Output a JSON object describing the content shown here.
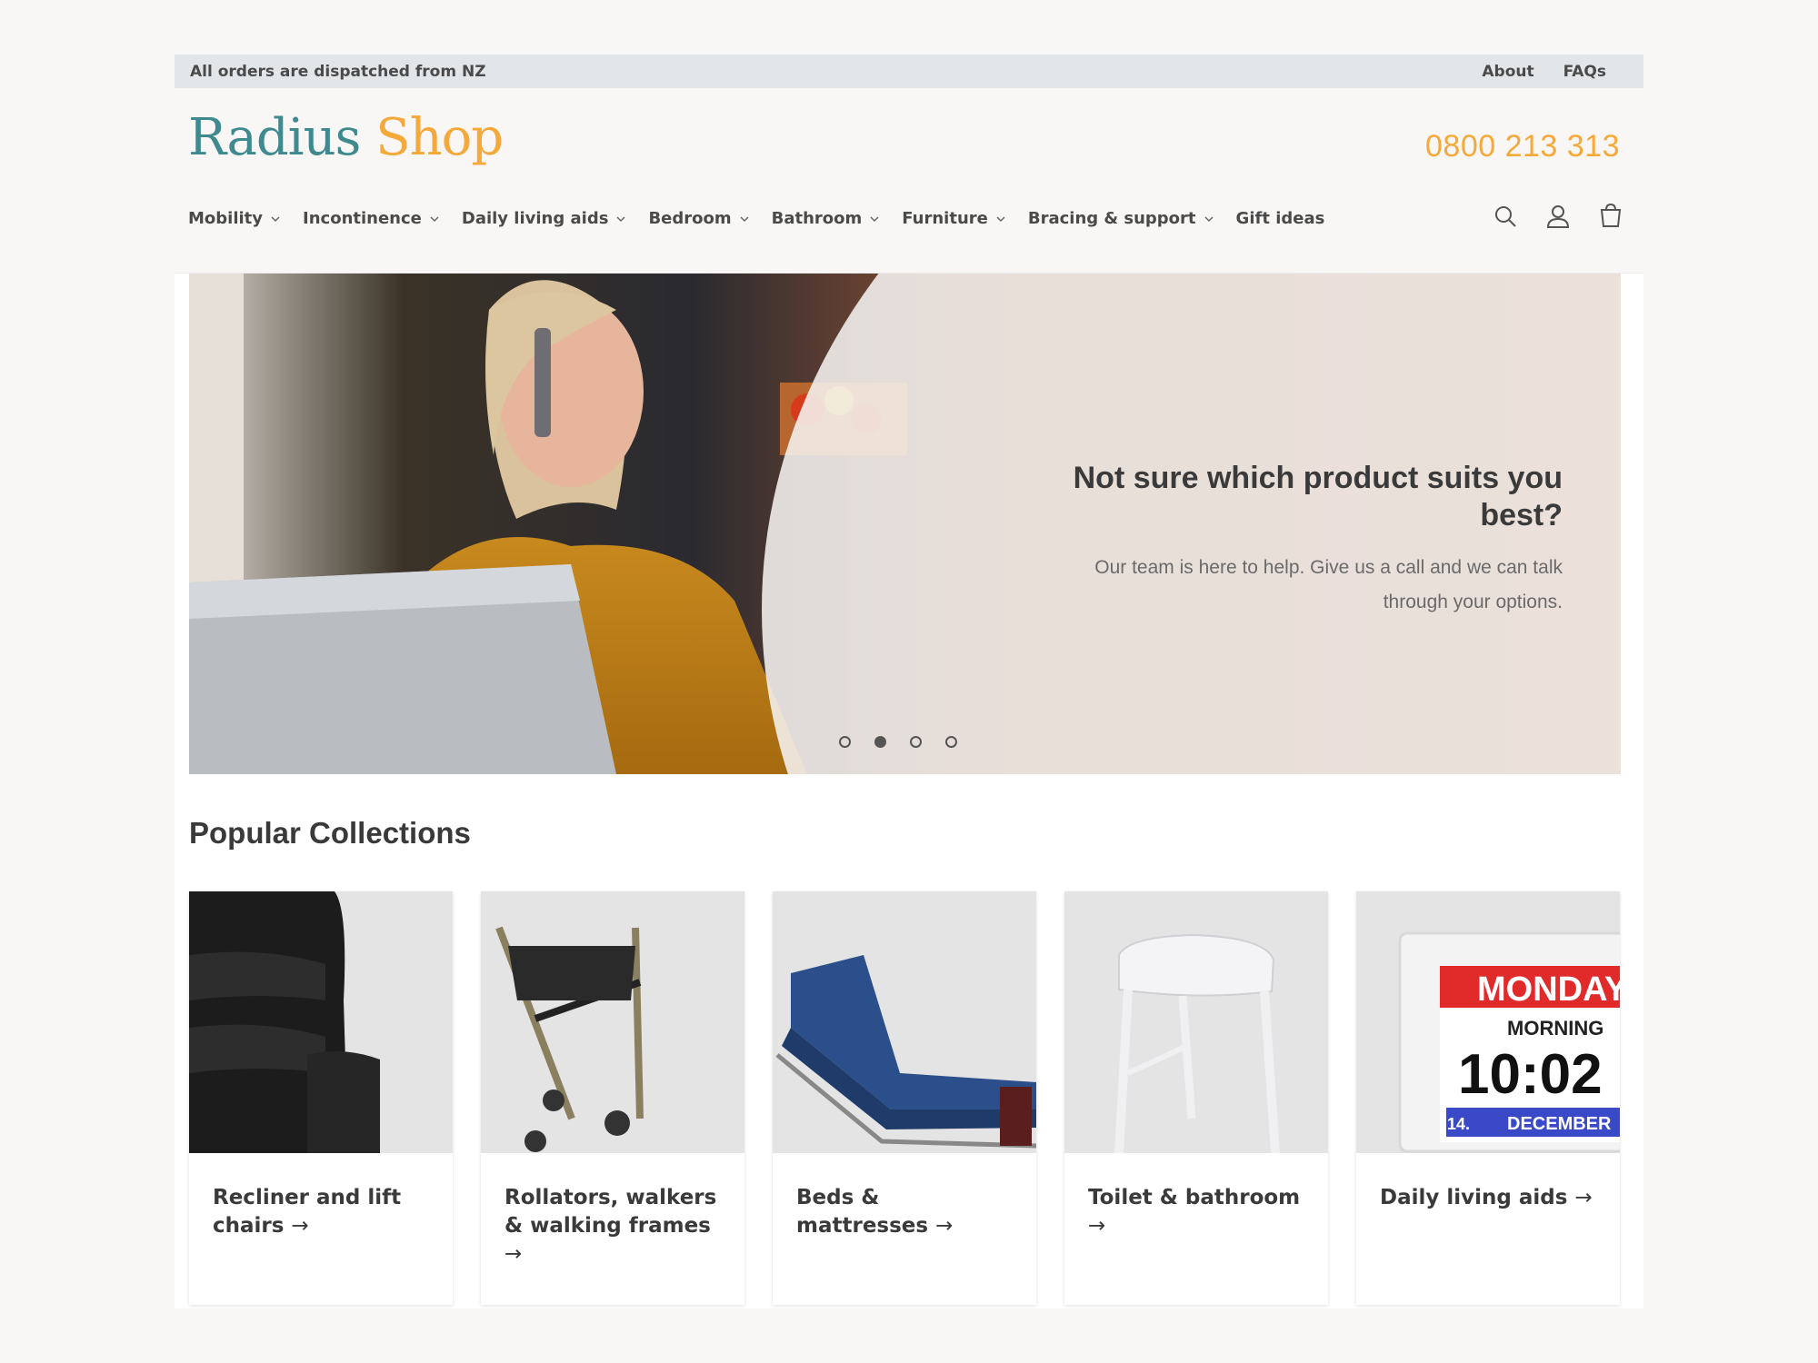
{
  "announcement": {
    "text": "All orders are dispatched from NZ",
    "links": [
      "About",
      "FAQs"
    ]
  },
  "header": {
    "logo_part1": "Radius",
    "logo_part2": " Shop",
    "phone": "0800 213 313",
    "nav": [
      {
        "label": "Mobility",
        "dropdown": true
      },
      {
        "label": "Incontinence",
        "dropdown": true
      },
      {
        "label": "Daily living aids",
        "dropdown": true
      },
      {
        "label": "Bedroom",
        "dropdown": true
      },
      {
        "label": "Bathroom",
        "dropdown": true
      },
      {
        "label": "Furniture",
        "dropdown": true
      },
      {
        "label": "Bracing & support",
        "dropdown": true
      },
      {
        "label": "Gift ideas",
        "dropdown": false
      }
    ],
    "icons": [
      "search-icon",
      "account-icon",
      "cart-icon"
    ]
  },
  "hero": {
    "title": "Not sure which product suits you best?",
    "subtitle": "Our team is here to help. Give us a call and we can talk through your options.",
    "slide_count": 4,
    "active_slide": 2
  },
  "collections": {
    "title": "Popular Collections",
    "items": [
      {
        "label": "Recliner and lift chairs",
        "arrow": "→"
      },
      {
        "label": "Rollators, walkers & walking frames",
        "arrow": "→"
      },
      {
        "label": "Beds & mattresses",
        "arrow": "→"
      },
      {
        "label": "Toilet & bathroom",
        "arrow": "→"
      },
      {
        "label": "Daily living aids",
        "arrow": "→"
      }
    ]
  },
  "clock_image": {
    "day": "MONDAY",
    "period": "MORNING",
    "time": "10:02",
    "date": "14.",
    "month": "DECEMBER"
  },
  "colors": {
    "teal": "#3f8a8f",
    "orange": "#f4a93a",
    "announce_bg": "#e3e6e8"
  }
}
